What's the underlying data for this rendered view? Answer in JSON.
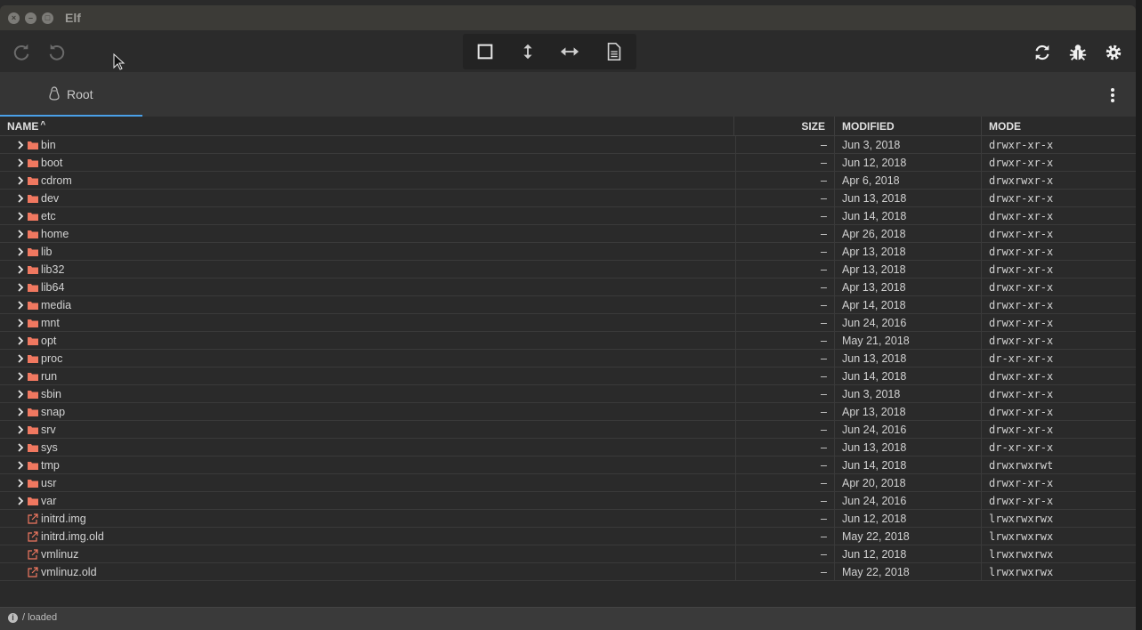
{
  "window": {
    "title": "Elf"
  },
  "toolbar": {
    "left_icons": [
      "redo-icon",
      "undo-icon"
    ],
    "center_icons": [
      "square-icon",
      "vertical-arrows-icon",
      "horizontal-arrows-icon",
      "document-icon"
    ],
    "right_icons": [
      "refresh-icon",
      "bug-icon",
      "settings-icon"
    ]
  },
  "tab": {
    "label": "Root",
    "icon": "linux-tux-icon",
    "accent": "#4aa0e8"
  },
  "table": {
    "headers": {
      "name": "NAME",
      "sort_indicator": "^",
      "size": "SIZE",
      "modified": "MODIFIED",
      "mode": "MODE"
    },
    "folder_color": "#f07860",
    "rows": [
      {
        "name": "bin",
        "type": "dir",
        "size": "–",
        "modified": "Jun 3, 2018",
        "mode": "drwxr-xr-x"
      },
      {
        "name": "boot",
        "type": "dir",
        "size": "–",
        "modified": "Jun 12, 2018",
        "mode": "drwxr-xr-x"
      },
      {
        "name": "cdrom",
        "type": "dir",
        "size": "–",
        "modified": "Apr 6, 2018",
        "mode": "drwxrwxr-x"
      },
      {
        "name": "dev",
        "type": "dir",
        "size": "–",
        "modified": "Jun 13, 2018",
        "mode": "drwxr-xr-x"
      },
      {
        "name": "etc",
        "type": "dir",
        "size": "–",
        "modified": "Jun 14, 2018",
        "mode": "drwxr-xr-x"
      },
      {
        "name": "home",
        "type": "dir",
        "size": "–",
        "modified": "Apr 26, 2018",
        "mode": "drwxr-xr-x"
      },
      {
        "name": "lib",
        "type": "dir",
        "size": "–",
        "modified": "Apr 13, 2018",
        "mode": "drwxr-xr-x"
      },
      {
        "name": "lib32",
        "type": "dir",
        "size": "–",
        "modified": "Apr 13, 2018",
        "mode": "drwxr-xr-x"
      },
      {
        "name": "lib64",
        "type": "dir",
        "size": "–",
        "modified": "Apr 13, 2018",
        "mode": "drwxr-xr-x"
      },
      {
        "name": "media",
        "type": "dir",
        "size": "–",
        "modified": "Apr 14, 2018",
        "mode": "drwxr-xr-x"
      },
      {
        "name": "mnt",
        "type": "dir",
        "size": "–",
        "modified": "Jun 24, 2016",
        "mode": "drwxr-xr-x"
      },
      {
        "name": "opt",
        "type": "dir",
        "size": "–",
        "modified": "May 21, 2018",
        "mode": "drwxr-xr-x"
      },
      {
        "name": "proc",
        "type": "dir",
        "size": "–",
        "modified": "Jun 13, 2018",
        "mode": "dr-xr-xr-x"
      },
      {
        "name": "run",
        "type": "dir",
        "size": "–",
        "modified": "Jun 14, 2018",
        "mode": "drwxr-xr-x"
      },
      {
        "name": "sbin",
        "type": "dir",
        "size": "–",
        "modified": "Jun 3, 2018",
        "mode": "drwxr-xr-x"
      },
      {
        "name": "snap",
        "type": "dir",
        "size": "–",
        "modified": "Apr 13, 2018",
        "mode": "drwxr-xr-x"
      },
      {
        "name": "srv",
        "type": "dir",
        "size": "–",
        "modified": "Jun 24, 2016",
        "mode": "drwxr-xr-x"
      },
      {
        "name": "sys",
        "type": "dir",
        "size": "–",
        "modified": "Jun 13, 2018",
        "mode": "dr-xr-xr-x"
      },
      {
        "name": "tmp",
        "type": "dir",
        "size": "–",
        "modified": "Jun 14, 2018",
        "mode": "drwxrwxrwt"
      },
      {
        "name": "usr",
        "type": "dir",
        "size": "–",
        "modified": "Apr 20, 2018",
        "mode": "drwxr-xr-x"
      },
      {
        "name": "var",
        "type": "dir",
        "size": "–",
        "modified": "Jun 24, 2016",
        "mode": "drwxr-xr-x"
      },
      {
        "name": "initrd.img",
        "type": "link",
        "size": "–",
        "modified": "Jun 12, 2018",
        "mode": "lrwxrwxrwx"
      },
      {
        "name": "initrd.img.old",
        "type": "link",
        "size": "–",
        "modified": "May 22, 2018",
        "mode": "lrwxrwxrwx"
      },
      {
        "name": "vmlinuz",
        "type": "link",
        "size": "–",
        "modified": "Jun 12, 2018",
        "mode": "lrwxrwxrwx"
      },
      {
        "name": "vmlinuz.old",
        "type": "link",
        "size": "–",
        "modified": "May 22, 2018",
        "mode": "lrwxrwxrwx"
      }
    ]
  },
  "status": {
    "text": "/ loaded",
    "icon": "info-icon"
  }
}
